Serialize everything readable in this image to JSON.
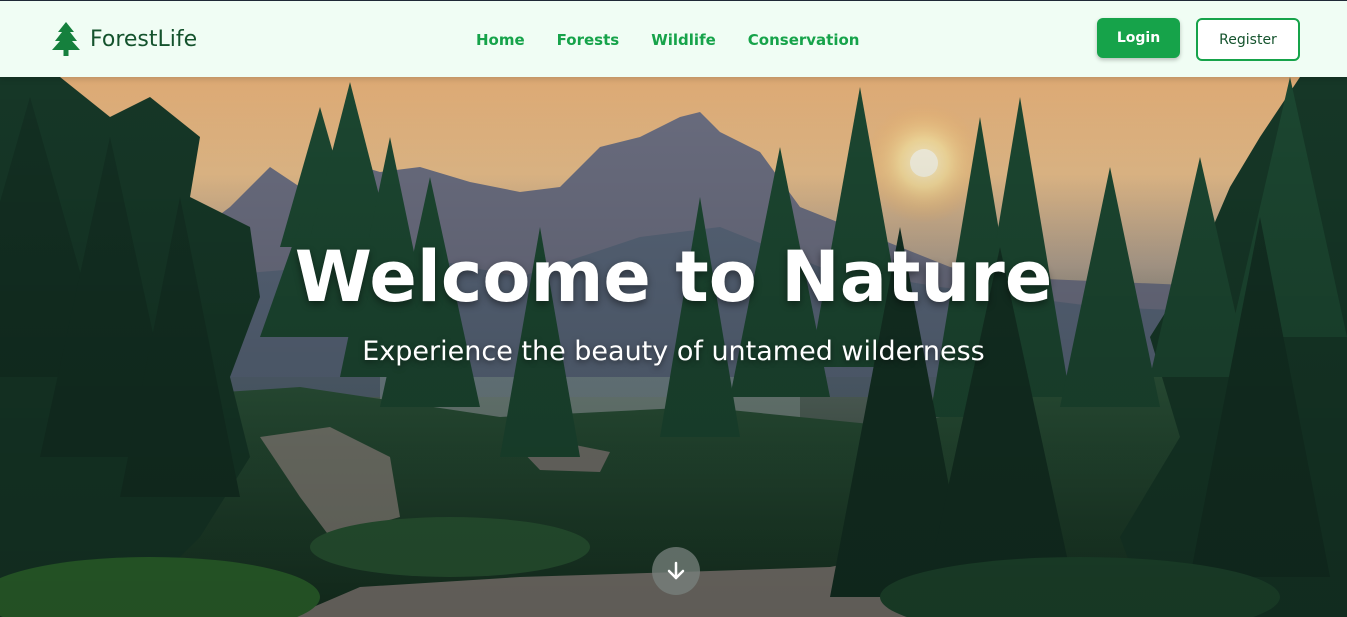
{
  "header": {
    "brand_name": "ForestLife",
    "brand_icon": "pine-tree-icon",
    "nav": [
      {
        "label": "Home"
      },
      {
        "label": "Forests"
      },
      {
        "label": "Wildlife"
      },
      {
        "label": "Conservation"
      }
    ],
    "login_label": "Login",
    "register_label": "Register"
  },
  "hero": {
    "title": "Welcome to Nature",
    "subtitle": "Experience the beauty of untamed wilderness",
    "scroll_icon": "arrow-down-icon"
  },
  "colors": {
    "brand_dark": "#14532d",
    "accent": "#16a34a",
    "navbar_bg": "#f0fdf4"
  }
}
